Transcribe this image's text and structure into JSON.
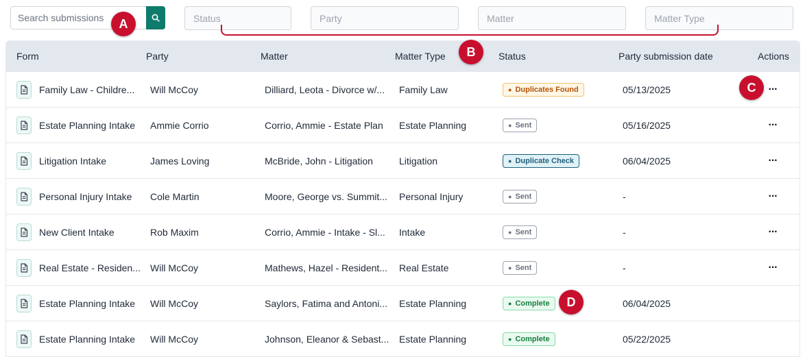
{
  "search": {
    "placeholder": "Search submissions"
  },
  "filters": [
    {
      "placeholder": "Status"
    },
    {
      "placeholder": "Party"
    },
    {
      "placeholder": "Matter"
    },
    {
      "placeholder": "Matter Type"
    }
  ],
  "annotations": {
    "a": "A",
    "b": "B",
    "c": "C",
    "d": "D"
  },
  "columns": [
    "Form",
    "Party",
    "Matter",
    "Matter Type",
    "Status",
    "Party submission date",
    "Actions"
  ],
  "rows": [
    {
      "form": "Family Law - Childre...",
      "party": "Will McCoy",
      "matter": "Dilliard, Leota - Divorce w/...",
      "matter_type": "Family Law",
      "status": "Duplicates Found",
      "status_kind": "warn",
      "date": "05/13/2025",
      "has_actions": true
    },
    {
      "form": "Estate Planning Intake",
      "party": "Ammie Corrio",
      "matter": "Corrio, Ammie - Estate Plan",
      "matter_type": "Estate Planning",
      "status": "Sent",
      "status_kind": "sent",
      "date": "05/16/2025",
      "has_actions": true
    },
    {
      "form": "Litigation Intake",
      "party": "James Loving",
      "matter": "McBride, John - Litigation",
      "matter_type": "Litigation",
      "status": "Duplicate Check",
      "status_kind": "info",
      "date": "06/04/2025",
      "has_actions": true
    },
    {
      "form": "Personal Injury Intake",
      "party": "Cole Martin",
      "matter": "Moore, George vs. Summit...",
      "matter_type": "Personal Injury",
      "status": "Sent",
      "status_kind": "sent",
      "date": "-",
      "has_actions": true
    },
    {
      "form": "New Client Intake",
      "party": "Rob Maxim",
      "matter": "Corrio, Ammie - Intake - Sl...",
      "matter_type": "Intake",
      "status": "Sent",
      "status_kind": "sent",
      "date": "-",
      "has_actions": true
    },
    {
      "form": "Real Estate - Residen...",
      "party": "Will McCoy",
      "matter": "Mathews, Hazel - Resident...",
      "matter_type": "Real Estate",
      "status": "Sent",
      "status_kind": "sent",
      "date": "-",
      "has_actions": true
    },
    {
      "form": "Estate Planning Intake",
      "party": "Will McCoy",
      "matter": "Saylors, Fatima and Antoni...",
      "matter_type": "Estate Planning",
      "status": "Complete",
      "status_kind": "ok",
      "date": "06/04/2025",
      "has_actions": false
    },
    {
      "form": "Estate Planning Intake",
      "party": "Will McCoy",
      "matter": "Johnson, Eleanor & Sebast...",
      "matter_type": "Estate Planning",
      "status": "Complete",
      "status_kind": "ok",
      "date": "05/22/2025",
      "has_actions": false
    }
  ],
  "colors": {
    "accent": "#0f7b6c",
    "marker": "#c8102e",
    "header_bg": "#e3e8ef"
  }
}
